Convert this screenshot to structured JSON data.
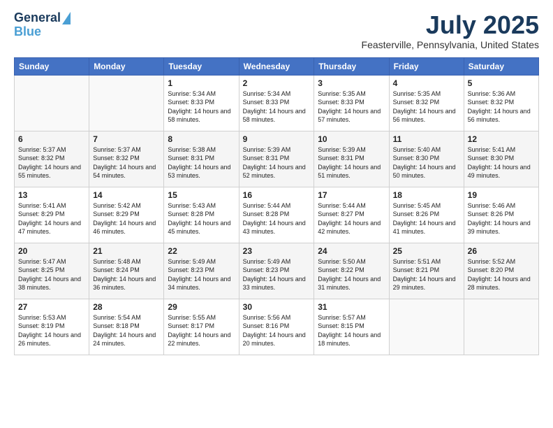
{
  "header": {
    "logo_line1": "General",
    "logo_line2": "Blue",
    "month": "July 2025",
    "location": "Feasterville, Pennsylvania, United States"
  },
  "weekdays": [
    "Sunday",
    "Monday",
    "Tuesday",
    "Wednesday",
    "Thursday",
    "Friday",
    "Saturday"
  ],
  "weeks": [
    [
      {
        "day": "",
        "sunrise": "",
        "sunset": "",
        "daylight": ""
      },
      {
        "day": "",
        "sunrise": "",
        "sunset": "",
        "daylight": ""
      },
      {
        "day": "1",
        "sunrise": "Sunrise: 5:34 AM",
        "sunset": "Sunset: 8:33 PM",
        "daylight": "Daylight: 14 hours and 58 minutes."
      },
      {
        "day": "2",
        "sunrise": "Sunrise: 5:34 AM",
        "sunset": "Sunset: 8:33 PM",
        "daylight": "Daylight: 14 hours and 58 minutes."
      },
      {
        "day": "3",
        "sunrise": "Sunrise: 5:35 AM",
        "sunset": "Sunset: 8:33 PM",
        "daylight": "Daylight: 14 hours and 57 minutes."
      },
      {
        "day": "4",
        "sunrise": "Sunrise: 5:35 AM",
        "sunset": "Sunset: 8:32 PM",
        "daylight": "Daylight: 14 hours and 56 minutes."
      },
      {
        "day": "5",
        "sunrise": "Sunrise: 5:36 AM",
        "sunset": "Sunset: 8:32 PM",
        "daylight": "Daylight: 14 hours and 56 minutes."
      }
    ],
    [
      {
        "day": "6",
        "sunrise": "Sunrise: 5:37 AM",
        "sunset": "Sunset: 8:32 PM",
        "daylight": "Daylight: 14 hours and 55 minutes."
      },
      {
        "day": "7",
        "sunrise": "Sunrise: 5:37 AM",
        "sunset": "Sunset: 8:32 PM",
        "daylight": "Daylight: 14 hours and 54 minutes."
      },
      {
        "day": "8",
        "sunrise": "Sunrise: 5:38 AM",
        "sunset": "Sunset: 8:31 PM",
        "daylight": "Daylight: 14 hours and 53 minutes."
      },
      {
        "day": "9",
        "sunrise": "Sunrise: 5:39 AM",
        "sunset": "Sunset: 8:31 PM",
        "daylight": "Daylight: 14 hours and 52 minutes."
      },
      {
        "day": "10",
        "sunrise": "Sunrise: 5:39 AM",
        "sunset": "Sunset: 8:31 PM",
        "daylight": "Daylight: 14 hours and 51 minutes."
      },
      {
        "day": "11",
        "sunrise": "Sunrise: 5:40 AM",
        "sunset": "Sunset: 8:30 PM",
        "daylight": "Daylight: 14 hours and 50 minutes."
      },
      {
        "day": "12",
        "sunrise": "Sunrise: 5:41 AM",
        "sunset": "Sunset: 8:30 PM",
        "daylight": "Daylight: 14 hours and 49 minutes."
      }
    ],
    [
      {
        "day": "13",
        "sunrise": "Sunrise: 5:41 AM",
        "sunset": "Sunset: 8:29 PM",
        "daylight": "Daylight: 14 hours and 47 minutes."
      },
      {
        "day": "14",
        "sunrise": "Sunrise: 5:42 AM",
        "sunset": "Sunset: 8:29 PM",
        "daylight": "Daylight: 14 hours and 46 minutes."
      },
      {
        "day": "15",
        "sunrise": "Sunrise: 5:43 AM",
        "sunset": "Sunset: 8:28 PM",
        "daylight": "Daylight: 14 hours and 45 minutes."
      },
      {
        "day": "16",
        "sunrise": "Sunrise: 5:44 AM",
        "sunset": "Sunset: 8:28 PM",
        "daylight": "Daylight: 14 hours and 43 minutes."
      },
      {
        "day": "17",
        "sunrise": "Sunrise: 5:44 AM",
        "sunset": "Sunset: 8:27 PM",
        "daylight": "Daylight: 14 hours and 42 minutes."
      },
      {
        "day": "18",
        "sunrise": "Sunrise: 5:45 AM",
        "sunset": "Sunset: 8:26 PM",
        "daylight": "Daylight: 14 hours and 41 minutes."
      },
      {
        "day": "19",
        "sunrise": "Sunrise: 5:46 AM",
        "sunset": "Sunset: 8:26 PM",
        "daylight": "Daylight: 14 hours and 39 minutes."
      }
    ],
    [
      {
        "day": "20",
        "sunrise": "Sunrise: 5:47 AM",
        "sunset": "Sunset: 8:25 PM",
        "daylight": "Daylight: 14 hours and 38 minutes."
      },
      {
        "day": "21",
        "sunrise": "Sunrise: 5:48 AM",
        "sunset": "Sunset: 8:24 PM",
        "daylight": "Daylight: 14 hours and 36 minutes."
      },
      {
        "day": "22",
        "sunrise": "Sunrise: 5:49 AM",
        "sunset": "Sunset: 8:23 PM",
        "daylight": "Daylight: 14 hours and 34 minutes."
      },
      {
        "day": "23",
        "sunrise": "Sunrise: 5:49 AM",
        "sunset": "Sunset: 8:23 PM",
        "daylight": "Daylight: 14 hours and 33 minutes."
      },
      {
        "day": "24",
        "sunrise": "Sunrise: 5:50 AM",
        "sunset": "Sunset: 8:22 PM",
        "daylight": "Daylight: 14 hours and 31 minutes."
      },
      {
        "day": "25",
        "sunrise": "Sunrise: 5:51 AM",
        "sunset": "Sunset: 8:21 PM",
        "daylight": "Daylight: 14 hours and 29 minutes."
      },
      {
        "day": "26",
        "sunrise": "Sunrise: 5:52 AM",
        "sunset": "Sunset: 8:20 PM",
        "daylight": "Daylight: 14 hours and 28 minutes."
      }
    ],
    [
      {
        "day": "27",
        "sunrise": "Sunrise: 5:53 AM",
        "sunset": "Sunset: 8:19 PM",
        "daylight": "Daylight: 14 hours and 26 minutes."
      },
      {
        "day": "28",
        "sunrise": "Sunrise: 5:54 AM",
        "sunset": "Sunset: 8:18 PM",
        "daylight": "Daylight: 14 hours and 24 minutes."
      },
      {
        "day": "29",
        "sunrise": "Sunrise: 5:55 AM",
        "sunset": "Sunset: 8:17 PM",
        "daylight": "Daylight: 14 hours and 22 minutes."
      },
      {
        "day": "30",
        "sunrise": "Sunrise: 5:56 AM",
        "sunset": "Sunset: 8:16 PM",
        "daylight": "Daylight: 14 hours and 20 minutes."
      },
      {
        "day": "31",
        "sunrise": "Sunrise: 5:57 AM",
        "sunset": "Sunset: 8:15 PM",
        "daylight": "Daylight: 14 hours and 18 minutes."
      },
      {
        "day": "",
        "sunrise": "",
        "sunset": "",
        "daylight": ""
      },
      {
        "day": "",
        "sunrise": "",
        "sunset": "",
        "daylight": ""
      }
    ]
  ]
}
